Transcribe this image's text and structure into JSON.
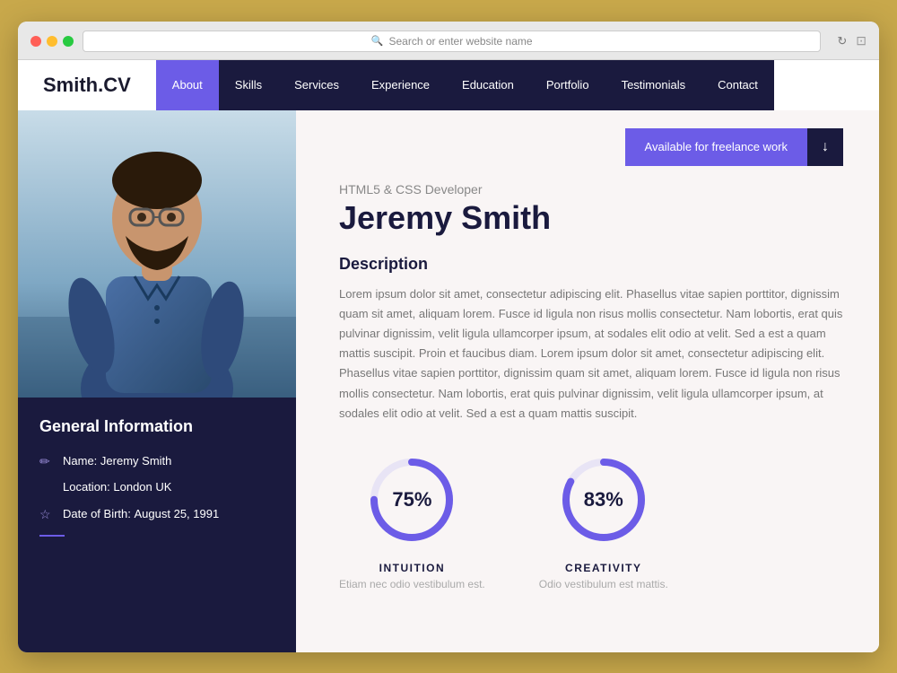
{
  "browser": {
    "address": "Search or enter website name"
  },
  "logo": "Smith.CV",
  "nav": {
    "items": [
      {
        "label": "About",
        "active": true
      },
      {
        "label": "Skills",
        "active": false
      },
      {
        "label": "Services",
        "active": false
      },
      {
        "label": "Experience",
        "active": false
      },
      {
        "label": "Education",
        "active": false
      },
      {
        "label": "Portfolio",
        "active": false
      },
      {
        "label": "Testimonials",
        "active": false
      },
      {
        "label": "Contact",
        "active": false
      }
    ]
  },
  "sidebar": {
    "heading": "General Information",
    "name_label": "Name:",
    "name_value": "Jeremy Smith",
    "location_label": "Location:",
    "location_value": "London UK",
    "dob_label": "Date of Birth:",
    "dob_value": "August 25, 1991"
  },
  "main": {
    "subtitle": "HTML5 & CSS Developer",
    "title": "Jeremy Smith",
    "freelance_btn": "Available for freelance work",
    "download_icon": "↓",
    "description_heading": "Description",
    "description": "Lorem ipsum dolor sit amet, consectetur adipiscing elit. Phasellus vitae sapien porttitor, dignissim quam sit amet, aliquam lorem. Fusce id ligula non risus mollis consectetur. Nam lobortis, erat quis pulvinar dignissim, velit ligula ullamcorper ipsum, at sodales elit odio at velit. Sed a est a quam mattis suscipit. Proin et faucibus diam. Lorem ipsum dolor sit amet, consectetur adipiscing elit. Phasellus vitae sapien porttitor, dignissim quam sit amet, aliquam lorem. Fusce id ligula non risus mollis consectetur. Nam lobortis, erat quis pulvinar dignissim, velit ligula ullamcorper ipsum, at sodales elit odio at velit. Sed a est a quam mattis suscipit."
  },
  "stats": [
    {
      "id": "intuition",
      "percent": "75%",
      "value": 75,
      "name": "INTUITION",
      "desc": "Etiam nec odio vestibulum est."
    },
    {
      "id": "creativity",
      "percent": "83%",
      "value": 83,
      "name": "CREATIVITY",
      "desc": "Odio vestibulum est mattis."
    }
  ]
}
